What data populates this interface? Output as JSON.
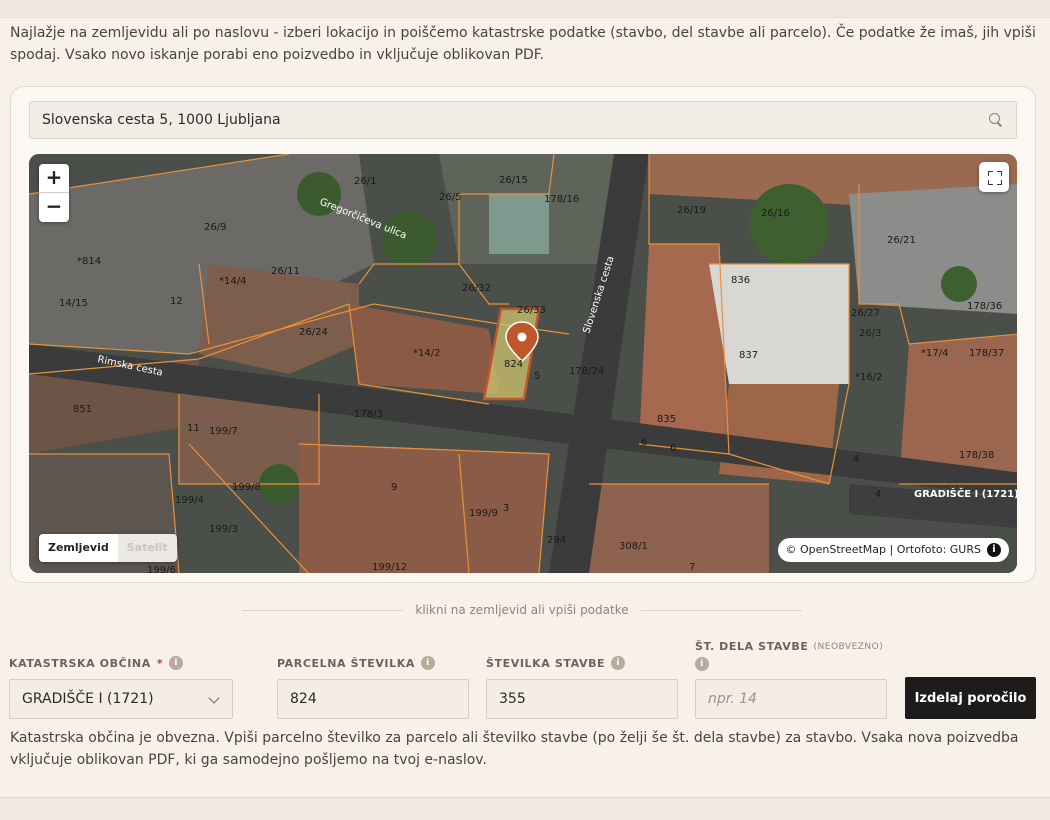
{
  "intro_text": "Najlažje na zemljevidu ali po naslovu - izberi lokacijo in poiščemo katastrske podatke (stavbo, del stavbe ali parcelo). Če podatke že imaš, jih vpiši spodaj. Vsako novo iskanje porabi eno poizvedbo in vključuje oblikovan PDF.",
  "search": {
    "value": "Slovenska cesta 5, 1000 Ljubljana",
    "icon": "search-icon"
  },
  "map": {
    "zoom_in": "+",
    "zoom_out": "−",
    "layers": {
      "map_label": "Zemljevid",
      "satellite_label": "Satelit",
      "active": "Zemljevid"
    },
    "attribution": "© OpenStreetMap | Ortofoto: GURS",
    "info_icon": "i",
    "selected_parcel": "824",
    "parcel_labels": [
      "26/1",
      "26/5",
      "26/15",
      "178/16",
      "26/19",
      "26/16",
      "26/9",
      "26/11",
      "*814",
      "*14/4",
      "26/21",
      "14/15",
      "12",
      "26/32",
      "26/33",
      "836",
      "26/27",
      "26/3",
      "178/36",
      "26/24",
      "*14/2",
      "824",
      "5",
      "837",
      "*17/4",
      "178/37",
      "178/24",
      "*16/2",
      "851",
      "178/3",
      "11",
      "199/7",
      "835",
      "6",
      "6",
      "178/38",
      "199/4",
      "199/8",
      "9",
      "199/9",
      "3",
      "4",
      "4",
      "199/3",
      "294",
      "308/1",
      "199/6",
      "199/12",
      "7",
      "GRADIŠČE I (1721)"
    ],
    "street_labels": [
      "Gregorčičeva ulica",
      "Slovenska cesta",
      "Rimska cesta"
    ]
  },
  "hint": "klikni na zemljevid ali vpiši podatke",
  "form": {
    "cadastral": {
      "label": "KATASTRSKA OBČINA",
      "required_mark": "*",
      "value": "GRADIŠČE I (1721)"
    },
    "parcel": {
      "label": "PARCELNA ŠTEVILKA",
      "value": "824"
    },
    "building": {
      "label": "ŠTEVILKA STAVBE",
      "value": "355"
    },
    "part": {
      "label": "ŠT. DELA STAVBE",
      "optional": "(NEOBVEZNO)",
      "placeholder": "npr. 14"
    },
    "info_icon": "i",
    "submit_label": "Izdelaj poročilo"
  },
  "helper_text": "Katastrska občina je obvezna. Vpiši parcelno številko za parcelo ali številko stavbe (po želji še št. dela stavbe) za stavbo. Vsaka nova poizvedba vključuje oblikovan PDF, ki ga samodejno pošljemo na tvoj e-naslov.",
  "colors": {
    "accent": "#c0562b",
    "parcel_lines": "#e8913a",
    "button": "#1e1c1a"
  }
}
